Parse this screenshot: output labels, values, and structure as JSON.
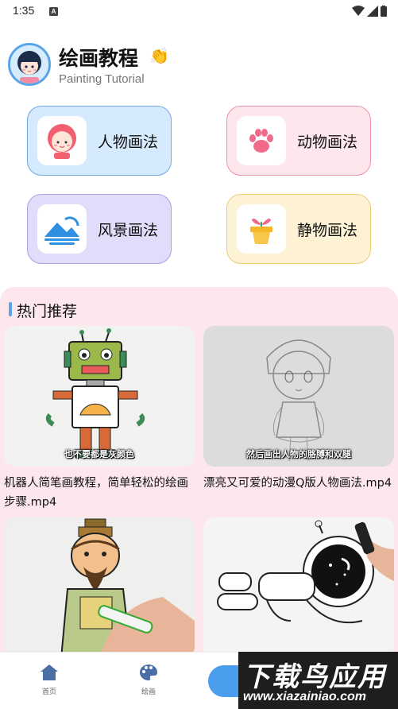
{
  "status_bar": {
    "time": "1:35",
    "notification_icon": "A"
  },
  "header": {
    "title": "绘画教程",
    "subtitle": "Painting Tutorial",
    "emoji": "👏"
  },
  "categories": [
    {
      "label": "人物画法",
      "icon": "girl-face-icon"
    },
    {
      "label": "动物画法",
      "icon": "paw-icon"
    },
    {
      "label": "风景画法",
      "icon": "mountain-icon"
    },
    {
      "label": "静物画法",
      "icon": "plant-pot-icon"
    }
  ],
  "hot": {
    "title": "热门推荐",
    "videos": [
      {
        "title": "机器人简笔画教程，简单轻松的绘画步骤.mp4",
        "caption": "也不要都是灰颜色"
      },
      {
        "title": "漂亮又可爱的动漫Q版人物画法.mp4",
        "caption": "然后画出人物的胳膊和双腿"
      },
      {
        "title": "",
        "caption": ""
      },
      {
        "title": "",
        "caption": ""
      }
    ]
  },
  "nav": {
    "home_label": "首页",
    "paint_label": "绘画"
  },
  "watermark": {
    "main": "下载鸟应用",
    "url": "www.xiazainiao.com"
  },
  "colors": {
    "accent": "#4a9eed",
    "hot_bg": "#fde7ec"
  }
}
